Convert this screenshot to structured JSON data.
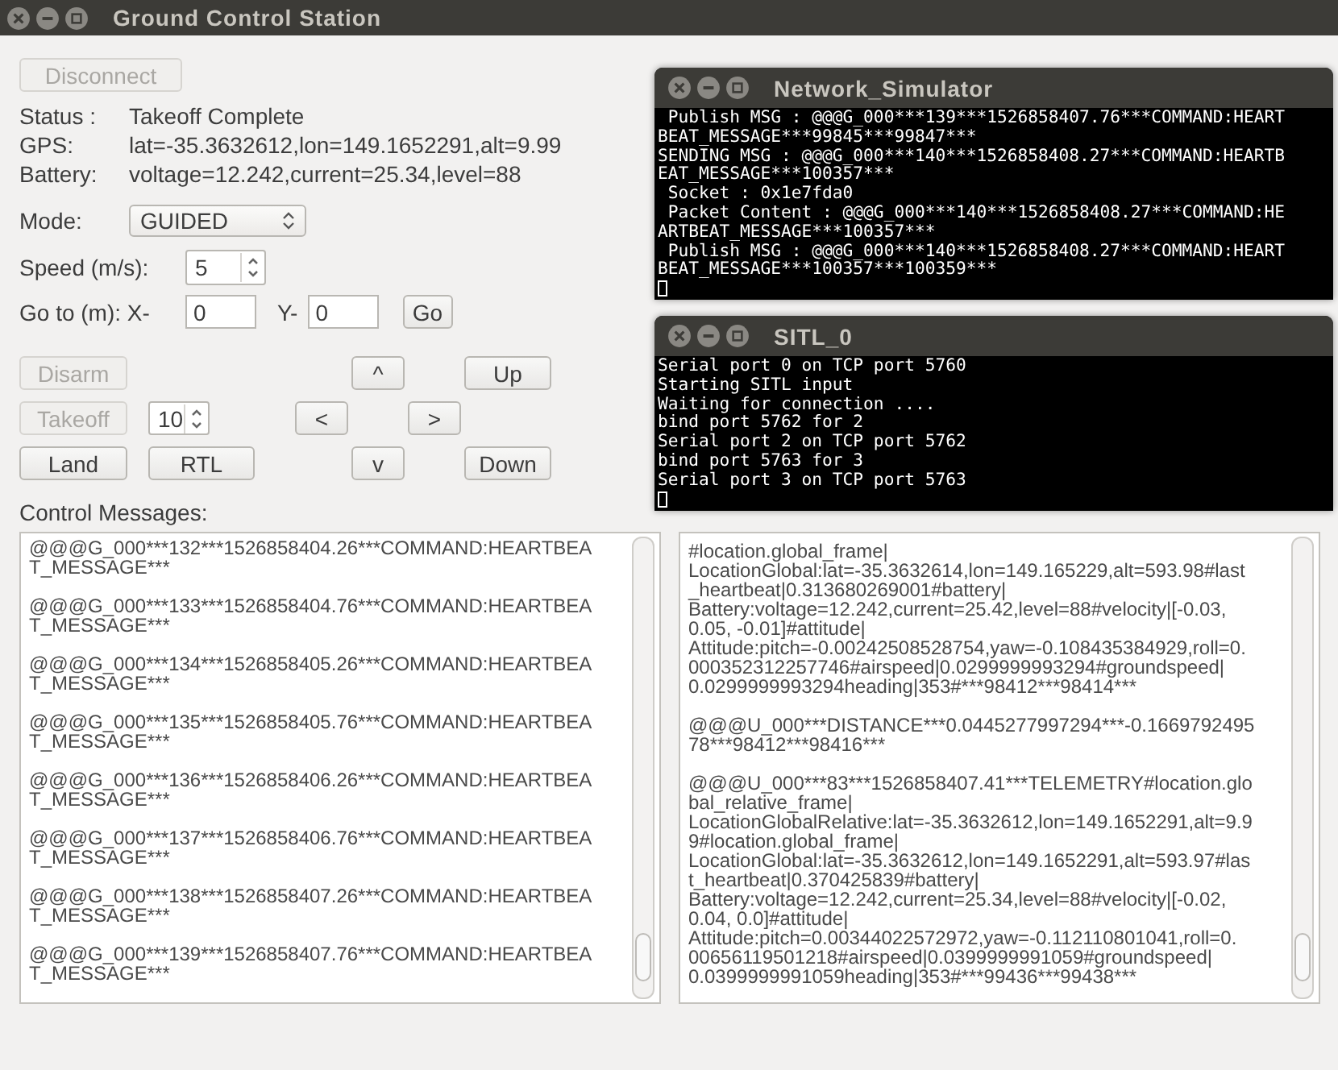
{
  "window": {
    "title": "Ground Control Station"
  },
  "disconnect": {
    "label": "Disconnect",
    "disabled": true
  },
  "status": [
    {
      "label": "Status :",
      "value": "Takeoff Complete"
    },
    {
      "label": "GPS:",
      "value": "lat=-35.3632612,lon=149.1652291,alt=9.99"
    },
    {
      "label": "Battery:",
      "value": "voltage=12.242,current=25.34,level=88"
    }
  ],
  "mode": {
    "label": "Mode:",
    "value": "GUIDED"
  },
  "speed": {
    "label": "Speed (m/s):",
    "value": "5"
  },
  "goto": {
    "label": "Go to (m): X-",
    "x_value": "0",
    "y_label": "Y-",
    "y_value": "0",
    "button": "Go"
  },
  "controls": [
    {
      "kind": "button",
      "label": "Disarm",
      "disabled": true
    },
    {
      "kind": "button",
      "label": "^",
      "disabled": false
    },
    {
      "kind": "button",
      "label": "Up",
      "disabled": false
    },
    {
      "kind": "button",
      "label": "Takeoff",
      "disabled": true
    },
    {
      "kind": "spin",
      "label": "10"
    },
    {
      "kind": "button",
      "label": "<",
      "disabled": false
    },
    {
      "kind": "button",
      "label": ">",
      "disabled": false
    },
    {
      "kind": "button",
      "label": "Land",
      "disabled": false
    },
    {
      "kind": "button",
      "label": "RTL",
      "disabled": false
    },
    {
      "kind": "button",
      "label": "v",
      "disabled": false
    },
    {
      "kind": "button",
      "label": "Down",
      "disabled": false
    }
  ],
  "control_messages": {
    "label": "Control Messages:",
    "messages": [
      [
        "@@@G_000***132***1526858404.26***COMMAND:HEARTBEA",
        "T_MESSAGE***"
      ],
      [
        "@@@G_000***133***1526858404.76***COMMAND:HEARTBEA",
        "T_MESSAGE***"
      ],
      [
        "@@@G_000***134***1526858405.26***COMMAND:HEARTBEA",
        "T_MESSAGE***"
      ],
      [
        "@@@G_000***135***1526858405.76***COMMAND:HEARTBEA",
        "T_MESSAGE***"
      ],
      [
        "@@@G_000***136***1526858406.26***COMMAND:HEARTBEA",
        "T_MESSAGE***"
      ],
      [
        "@@@G_000***137***1526858406.76***COMMAND:HEARTBEA",
        "T_MESSAGE***"
      ],
      [
        "@@@G_000***138***1526858407.26***COMMAND:HEARTBEA",
        "T_MESSAGE***"
      ],
      [
        "@@@G_000***139***1526858407.76***COMMAND:HEARTBEA",
        "T_MESSAGE***"
      ]
    ]
  },
  "telemetry_messages": {
    "messages": [
      [
        "#location.global_frame|",
        "LocationGlobal:lat=-35.3632614,lon=149.165229,alt=593.98#last",
        "_heartbeat|0.313680269001#battery|",
        "Battery:voltage=12.242,current=25.42,level=88#velocity|[-0.03,",
        "0.05, -0.01]#attitude|",
        "Attitude:pitch=-0.00242508528754,yaw=-0.108435384929,roll=0.",
        "000352312257746#airspeed|0.0299999993294#groundspeed|",
        "0.0299999993294heading|353#***98412***98414***"
      ],
      [
        "@@@U_000***DISTANCE***0.0445277997294***-0.1669792495",
        "78***98412***98416***"
      ],
      [
        "@@@U_000***83***1526858407.41***TELEMETRY#location.glo",
        "bal_relative_frame|",
        "LocationGlobalRelative:lat=-35.3632612,lon=149.1652291,alt=9.9",
        "9#location.global_frame|",
        "LocationGlobal:lat=-35.3632612,lon=149.1652291,alt=593.97#las",
        "t_heartbeat|0.370425839#battery|",
        "Battery:voltage=12.242,current=25.34,level=88#velocity|[-0.02,",
        "0.04, 0.0]#attitude|",
        "Attitude:pitch=0.00344022572972,yaw=-0.112110801041,roll=0.",
        "00656119501218#airspeed|0.0399999991059#groundspeed|",
        "0.0399999991059heading|353#***99436***99438***"
      ]
    ]
  },
  "terminals": [
    {
      "title": "Network_Simulator",
      "lines": [
        " Publish MSG : @@@G_000***139***1526858407.76***COMMAND:HEART",
        "BEAT_MESSAGE***99845***99847***",
        "SENDING MSG : @@@G_000***140***1526858408.27***COMMAND:HEARTB",
        "EAT_MESSAGE***100357***",
        " Socket : 0x1e7fda0",
        " Packet Content : @@@G_000***140***1526858408.27***COMMAND:HE",
        "ARTBEAT_MESSAGE***100357***",
        " Publish MSG : @@@G_000***140***1526858408.27***COMMAND:HEART",
        "BEAT_MESSAGE***100357***100359***"
      ]
    },
    {
      "title": "SITL_0",
      "lines": [
        "Serial port 0 on TCP port 5760",
        "Starting SITL input",
        "Waiting for connection ....",
        "bind port 5762 for 2",
        "Serial port 2 on TCP port 5762",
        "bind port 5763 for 3",
        "Serial port 3 on TCP port 5763"
      ]
    }
  ]
}
